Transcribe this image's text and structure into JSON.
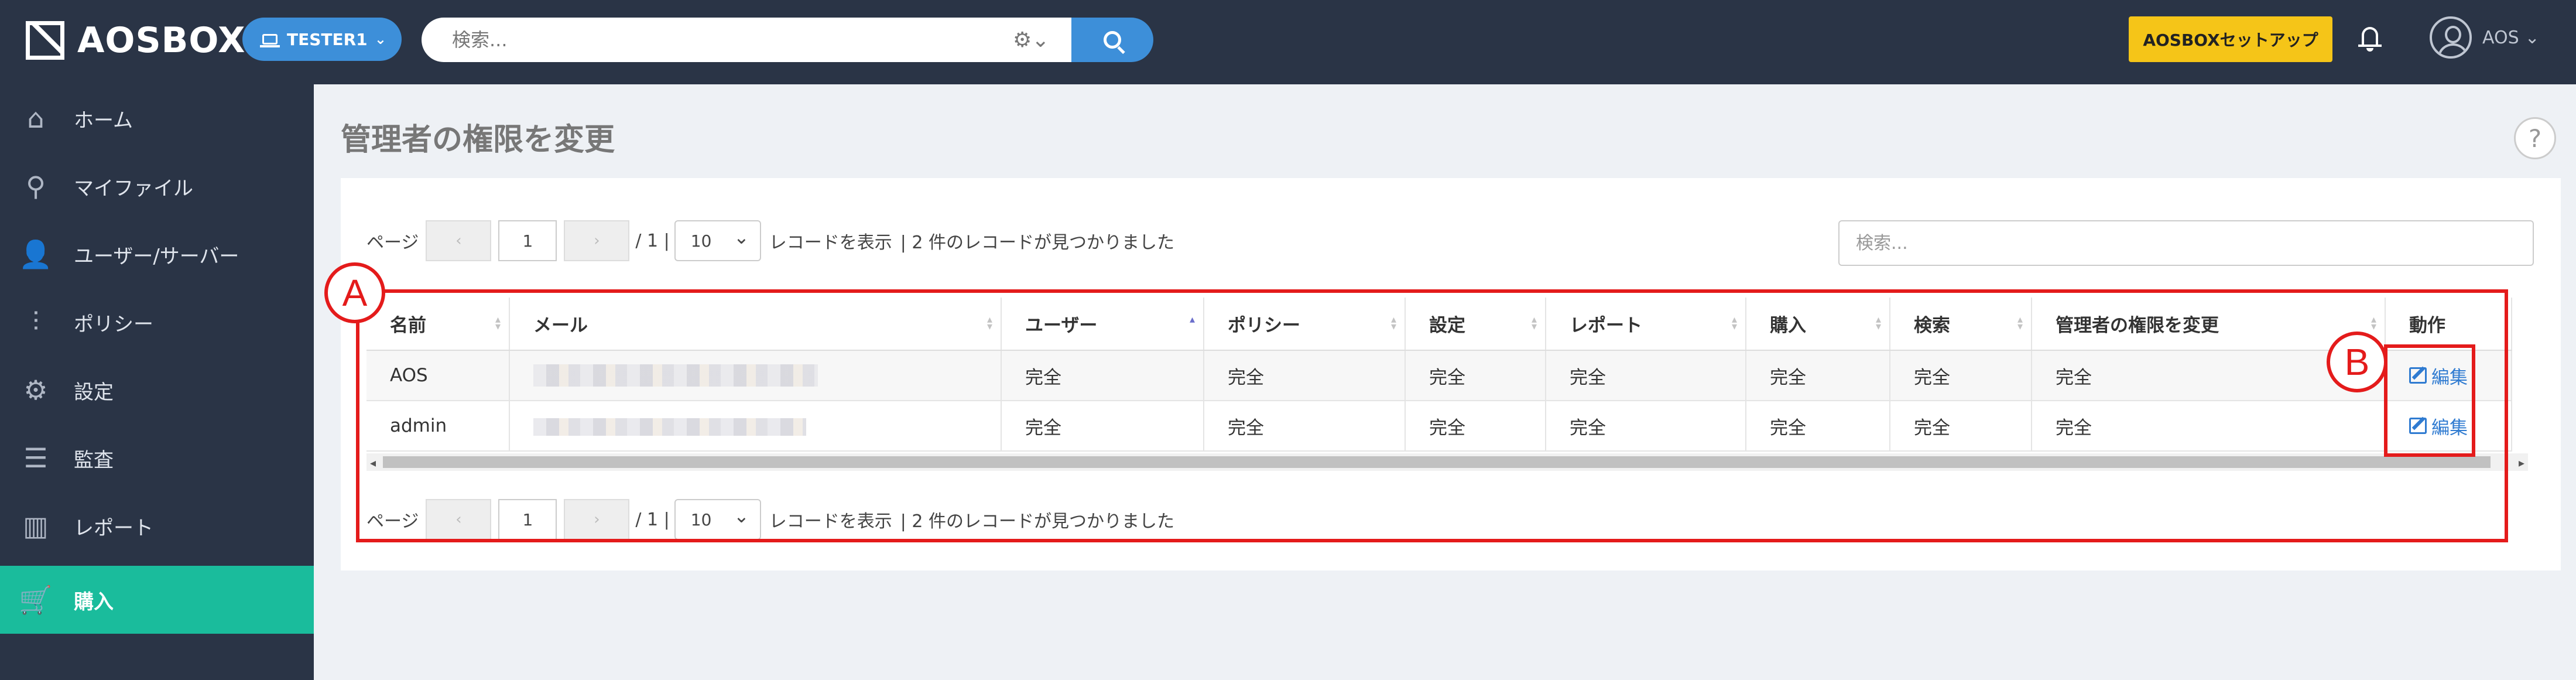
{
  "app": {
    "brand": "AOSBOX",
    "tenant_button": "TESTER1",
    "search_placeholder": "検索...",
    "setup_button": "AOSBOXセットアップ",
    "user_name": "AOS"
  },
  "sidebar": {
    "items": [
      {
        "label": "ホーム",
        "icon": "home-icon"
      },
      {
        "label": "マイファイル",
        "icon": "search-icon"
      },
      {
        "label": "ユーザー/サーバー",
        "icon": "users-icon"
      },
      {
        "label": "ポリシー",
        "icon": "sliders-icon"
      },
      {
        "label": "設定",
        "icon": "gear-icon"
      },
      {
        "label": "監査",
        "icon": "list-icon"
      },
      {
        "label": "レポート",
        "icon": "bar-chart-icon"
      },
      {
        "label": "購入",
        "icon": "cart-icon",
        "active": true
      }
    ]
  },
  "page": {
    "title": "管理者の権限を変更",
    "help_symbol": "?"
  },
  "pager": {
    "page_label": "ページ",
    "prev_symbol": "‹",
    "next_symbol": "›",
    "current_page": "1",
    "total_pages": "/ 1 |",
    "page_size": "10",
    "show_records_label": "レコードを表示",
    "found_label": "| 2 件のレコードが見つかりました"
  },
  "table": {
    "search_placeholder": "検索...",
    "columns": [
      "名前",
      "メール",
      "ユーザー",
      "ポリシー",
      "設定",
      "レポート",
      "購入",
      "検索",
      "管理者の権限を変更",
      "動作"
    ],
    "rows": [
      {
        "name": "AOS",
        "user": "完全",
        "policy": "完全",
        "settings": "完全",
        "report": "完全",
        "purchase": "完全",
        "search": "完全",
        "admin_rights": "完全",
        "action": "編集"
      },
      {
        "name": "admin",
        "user": "完全",
        "policy": "完全",
        "settings": "完全",
        "report": "完全",
        "purchase": "完全",
        "search": "完全",
        "admin_rights": "完全",
        "action": "編集"
      }
    ],
    "scroll_left": "◂",
    "scroll_right": "▸"
  },
  "annotations": {
    "a": "A",
    "b": "B",
    "color": "#e41b1b"
  },
  "colors": {
    "topbar": "#2a3446",
    "accent_blue": "#3d8fd9",
    "active_teal": "#1abc9c",
    "setup_yellow": "#f5c518"
  }
}
